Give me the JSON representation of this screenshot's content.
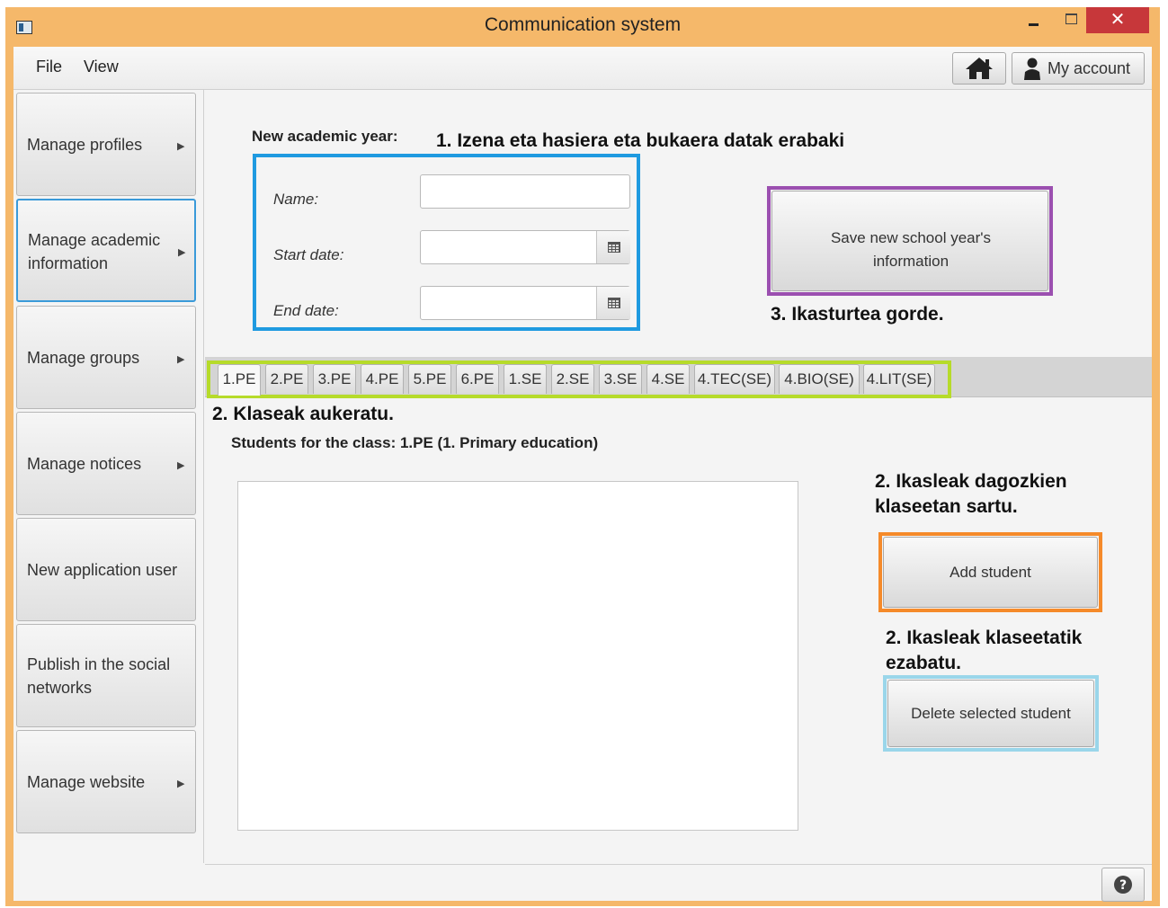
{
  "window": {
    "title": "Communication system",
    "close_glyph": "✕"
  },
  "menu": {
    "file": "File",
    "view": "View"
  },
  "toolbar": {
    "home_icon": "home-icon",
    "account_label": "My account"
  },
  "sidebar": {
    "items": [
      {
        "label": "Manage profiles",
        "has_arrow": true
      },
      {
        "label": "Manage academic information",
        "has_arrow": true,
        "active": true
      },
      {
        "label": "Manage groups",
        "has_arrow": true
      },
      {
        "label": "Manage notices",
        "has_arrow": true
      },
      {
        "label": "New application user",
        "has_arrow": false
      },
      {
        "label": "Publish in the social networks",
        "has_arrow": false
      },
      {
        "label": "Manage website",
        "has_arrow": true
      }
    ],
    "arrow_glyph": "▶"
  },
  "form": {
    "section_title": "New academic year:",
    "name_label": "Name:",
    "start_label": "Start date:",
    "end_label": "End date:",
    "name_value": "",
    "start_value": "",
    "end_value": "",
    "save_button": "Save new school year's information"
  },
  "annotations": {
    "step1": "1. Izena eta hasiera eta bukaera datak erabaki",
    "step3": "3. Ikasturtea gorde.",
    "step2_classes": "2. Klaseak aukeratu.",
    "step2_add": "2. Ikasleak dagozkien klaseetan sartu.",
    "step2_delete": "2. Ikasleak klaseetatik ezabatu."
  },
  "tabs": [
    "1.PE",
    "2.PE",
    "3.PE",
    "4.PE",
    "5.PE",
    "6.PE",
    "1.SE",
    "2.SE",
    "3.SE",
    "4.SE",
    "4.TEC(SE)",
    "4.BIO(SE)",
    "4.LIT(SE)"
  ],
  "selected_tab": "1.PE",
  "students": {
    "caption": "Students for the class: 1.PE (1. Primary education)",
    "items": []
  },
  "buttons": {
    "add_student": "Add student",
    "delete_student": "Delete selected student"
  },
  "colors": {
    "window_frame": "#f5b86a",
    "close_button": "#c7373a",
    "highlight_form": "#1f9ae0",
    "highlight_save": "#9b4fb0",
    "highlight_tabs": "#b6db2a",
    "highlight_add": "#f58a2a",
    "highlight_delete": "#9ad6ea",
    "active_sidebar_border": "#3a9ad9"
  }
}
